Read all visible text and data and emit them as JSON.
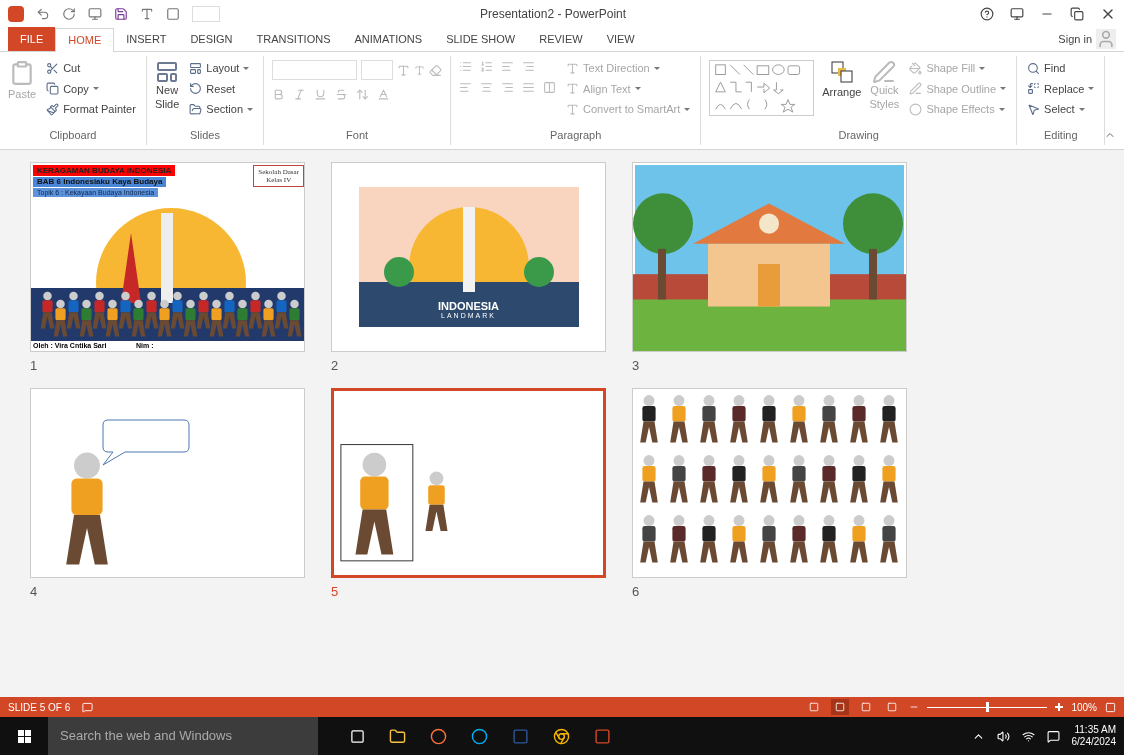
{
  "window": {
    "title": "Presentation2 - PowerPoint",
    "sign_in": "Sign in"
  },
  "tabs": [
    {
      "label": "FILE",
      "kind": "file",
      "selected": false
    },
    {
      "label": "HOME",
      "kind": "tab",
      "selected": true
    },
    {
      "label": "INSERT",
      "kind": "tab",
      "selected": false
    },
    {
      "label": "DESIGN",
      "kind": "tab",
      "selected": false
    },
    {
      "label": "TRANSITIONS",
      "kind": "tab",
      "selected": false
    },
    {
      "label": "ANIMATIONS",
      "kind": "tab",
      "selected": false
    },
    {
      "label": "SLIDE SHOW",
      "kind": "tab",
      "selected": false
    },
    {
      "label": "REVIEW",
      "kind": "tab",
      "selected": false
    },
    {
      "label": "VIEW",
      "kind": "tab",
      "selected": false
    }
  ],
  "groups": [
    {
      "kind": "clipboard",
      "label": "Clipboard",
      "items": [
        {
          "label": "Paste",
          "disabled": true
        },
        {
          "label": "Cut",
          "disabled": false
        },
        {
          "label": "Copy",
          "disabled": false
        },
        {
          "label": "Format Painter",
          "disabled": false
        }
      ]
    },
    {
      "kind": "slides",
      "label": "Slides",
      "items": [
        {
          "label": "New",
          "disabled": false
        },
        {
          "label": "Slide",
          "disabled": false
        },
        {
          "label": "Layout",
          "disabled": false
        },
        {
          "label": "Reset",
          "disabled": false
        },
        {
          "label": "Section",
          "disabled": false
        }
      ]
    },
    {
      "kind": "font",
      "label": "Font"
    },
    {
      "kind": "paragraph",
      "label": "Paragraph",
      "items": [
        {
          "label": "Text Direction",
          "disabled": true
        },
        {
          "label": "Align Text",
          "disabled": true
        },
        {
          "label": "Convert to SmartArt",
          "disabled": true
        }
      ]
    },
    {
      "kind": "drawing",
      "label": "Drawing",
      "items": [
        {
          "label": "Arrange",
          "disabled": false
        },
        {
          "label": "Quick",
          "disabled": true
        },
        {
          "label": "Styles",
          "disabled": true
        },
        {
          "label": "Shape Fill",
          "disabled": true
        },
        {
          "label": "Shape Outline",
          "disabled": true
        },
        {
          "label": "Shape Effects",
          "disabled": true
        }
      ]
    },
    {
      "kind": "editing",
      "label": "Editing",
      "items": [
        {
          "label": "Find",
          "disabled": false
        },
        {
          "label": "Replace",
          "disabled": false
        },
        {
          "label": "Select",
          "disabled": false
        }
      ]
    }
  ],
  "slides": [
    {
      "number": "1",
      "kind": "title",
      "selected": false,
      "texts": [
        "KERAGAMAN BUDAYA INDONESIA",
        "BAB 6  Indonesiaku Kaya Budaya",
        "Topik 6 : Kekayaan Budaya Indonesia",
        "Sekolah Dasar",
        "Kelas IV",
        "Oleh : Vira Cntika Sari",
        "Nim :"
      ]
    },
    {
      "number": "2",
      "kind": "landmark",
      "selected": false,
      "texts": [
        "INDONESIA",
        "LANDMARK"
      ]
    },
    {
      "number": "3",
      "kind": "school",
      "selected": false
    },
    {
      "number": "4",
      "kind": "bubble",
      "selected": false
    },
    {
      "number": "5",
      "kind": "figures",
      "selected": true
    },
    {
      "number": "6",
      "kind": "crowd",
      "selected": false
    }
  ],
  "status_bar": {
    "slide_info": "SLIDE 5 OF 6",
    "views": [
      {
        "selected": false
      },
      {
        "selected": true
      },
      {
        "selected": false
      },
      {
        "selected": false
      }
    ],
    "zoom": "100%",
    "zoom_level": {
      "level": 0.5
    }
  },
  "taskbar": {
    "search": {
      "placeholder": "Search the web and Windows"
    },
    "time": "11:35 AM",
    "date": "6/24/2024"
  }
}
